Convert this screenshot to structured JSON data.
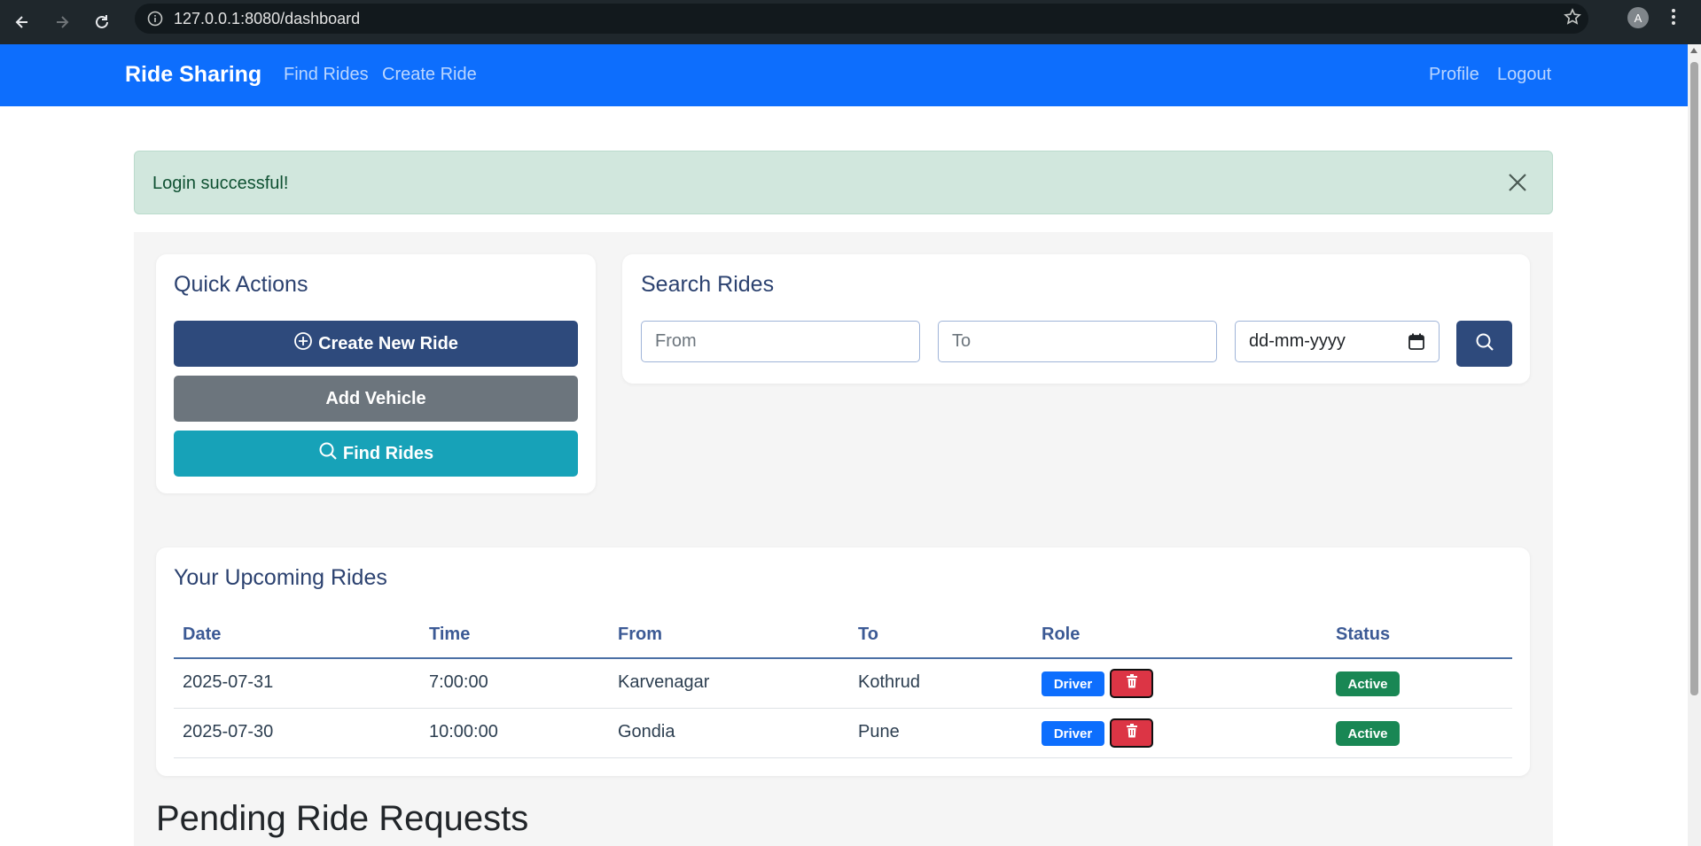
{
  "browser": {
    "url": "127.0.0.1:8080/dashboard",
    "profile_initial": "A"
  },
  "navbar": {
    "brand": "Ride Sharing",
    "links": [
      "Find Rides",
      "Create Ride"
    ],
    "right_links": [
      "Profile",
      "Logout"
    ]
  },
  "alert": {
    "message": "Login successful!"
  },
  "quick_actions": {
    "title": "Quick Actions",
    "create_label": "Create New Ride",
    "add_vehicle_label": "Add Vehicle",
    "find_label": "Find Rides"
  },
  "search": {
    "title": "Search Rides",
    "from_placeholder": "From",
    "to_placeholder": "To",
    "date_value": "dd-mm-yyyy"
  },
  "upcoming": {
    "title": "Your Upcoming Rides",
    "headers": [
      "Date",
      "Time",
      "From",
      "To",
      "Role",
      "Status"
    ],
    "rows": [
      {
        "date": "2025-07-31",
        "time": "7:00:00",
        "from": "Karvenagar",
        "to": "Kothrud",
        "role": "Driver",
        "status": "Active"
      },
      {
        "date": "2025-07-30",
        "time": "10:00:00",
        "from": "Gondia",
        "to": "Pune",
        "role": "Driver",
        "status": "Active"
      }
    ]
  },
  "pending": {
    "title": "Pending Ride Requests"
  },
  "colors": {
    "navbar": "#0d6efd",
    "primary_dark": "#2e4a7c",
    "alert_bg": "#d1e7dd",
    "danger": "#dc3545",
    "success": "#198754",
    "info": "#17a2b8"
  }
}
